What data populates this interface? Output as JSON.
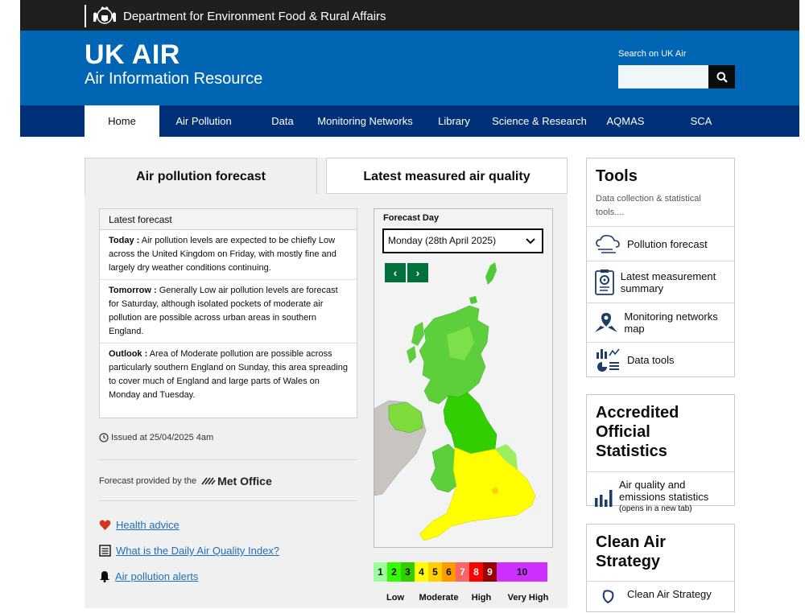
{
  "topbar": {
    "department": "Department for Environment Food & Rural Affairs"
  },
  "brand": {
    "title": "UK AIR",
    "subtitle": "Air Information Resource"
  },
  "search": {
    "label": "Search on UK Air",
    "value": ""
  },
  "nav": {
    "items": [
      "Home",
      "Air Pollution",
      "Data",
      "Monitoring Networks",
      "Library",
      "Science & Research",
      "AQMAS",
      "SCA"
    ],
    "active": "Home"
  },
  "tabs": {
    "forecast": "Air pollution forecast",
    "measured": "Latest measured air quality"
  },
  "forecast": {
    "heading": "Latest forecast",
    "today_label": "Today :",
    "today_text": " Air pollution levels are expected to be chiefly Low across the United Kingdom on Friday, with mostly fine and largely dry weather conditions continuing.",
    "tomorrow_label": "Tomorrow :",
    "tomorrow_text": " Generally Low air pollution levels are forecast for Saturday, although isolated pockets of moderate air pollution are possible across urban areas in southern England.",
    "outlook_label": "Outlook :",
    "outlook_text": " Area of Moderate pollution are possible across particularly southern England on Sunday, this area spreading to cover much of England and large parts of Wales on Monday and Tuesday.",
    "issued": "Issued at 25/04/2025 4am",
    "provided_by": "Forecast provided by the",
    "provider": "Met Office"
  },
  "links": {
    "health": "Health advice",
    "daqi": "What is the Daily Air Quality Index?",
    "alerts": "Air pollution alerts"
  },
  "map": {
    "day_label": "Forecast Day",
    "selected_day": "Monday (28th April 2025)"
  },
  "scale": {
    "bands": [
      {
        "n": "1",
        "color": "#9cff9c"
      },
      {
        "n": "2",
        "color": "#31ff00"
      },
      {
        "n": "3",
        "color": "#31cf00"
      },
      {
        "n": "4",
        "color": "#ffff00"
      },
      {
        "n": "5",
        "color": "#ffcf00"
      },
      {
        "n": "6",
        "color": "#ff9a00"
      },
      {
        "n": "7",
        "color": "#ff6464"
      },
      {
        "n": "8",
        "color": "#ff0000"
      },
      {
        "n": "9",
        "color": "#990000"
      },
      {
        "n": "10",
        "color": "#ce30ff"
      }
    ],
    "labels": {
      "low": "Low",
      "moderate": "Moderate",
      "high": "High",
      "very_high": "Very High"
    }
  },
  "tools": {
    "title": "Tools",
    "subtitle": "Data collection & statistical tools....",
    "items": [
      "Pollution forecast",
      "Latest measurement summary",
      "Monitoring networks map",
      "Data tools"
    ]
  },
  "accredited": {
    "title": "Accredited Official Statistics",
    "item": "Air quality and emissions statistics",
    "note": "(opens in a new tab)"
  },
  "clean": {
    "title": "Clean Air Strategy",
    "item": "Clean Air Strategy"
  }
}
